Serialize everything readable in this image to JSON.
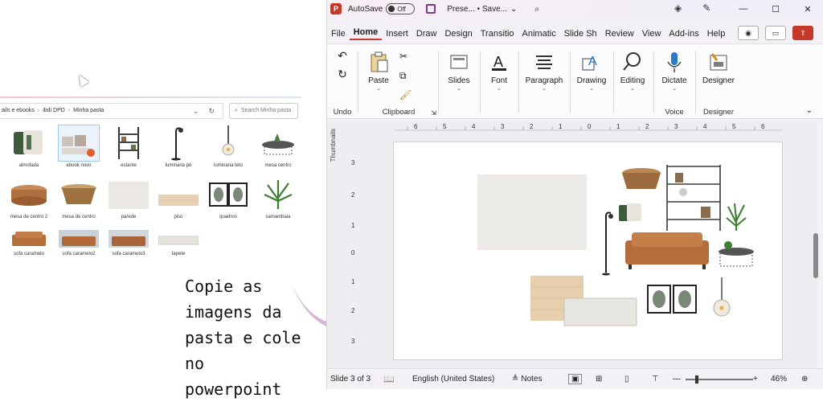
{
  "explorer": {
    "breadcrumb": [
      "ails e ebooks",
      "ibdi DPD",
      "Minha pasta"
    ],
    "search_placeholder": "Search Minha pasta",
    "files": [
      {
        "name": "almofada"
      },
      {
        "name": "ebook novo"
      },
      {
        "name": "estante"
      },
      {
        "name": "luminaria pé"
      },
      {
        "name": "luminaria teto"
      },
      {
        "name": "mesa centro"
      },
      {
        "name": "mesa de centro 2"
      },
      {
        "name": "mesa de centro"
      },
      {
        "name": "parede"
      },
      {
        "name": "piso"
      },
      {
        "name": "quadros"
      },
      {
        "name": "samambaia"
      },
      {
        "name": "sofa caramelo"
      },
      {
        "name": "sofa caramelo2"
      },
      {
        "name": "sofa caramelo3"
      },
      {
        "name": "tapete"
      }
    ]
  },
  "annotation": {
    "lines": [
      "Copie as",
      "imagens da",
      "pasta e cole no",
      "powerpoint"
    ],
    "arrow_color": "#d7b6d8"
  },
  "ppt": {
    "titlebar": {
      "autosave_label": "AutoSave",
      "toggle_state": "Off",
      "doc_title": "Prese... • Save...",
      "window_controls": [
        "—",
        "☐",
        "✕"
      ]
    },
    "tabs": [
      "File",
      "Home",
      "Insert",
      "Draw",
      "Design",
      "Transitio",
      "Animatic",
      "Slide Sh",
      "Review",
      "View",
      "Add-ins",
      "Help"
    ],
    "active_tab": "Home",
    "ribbon": {
      "undo_label": "Undo",
      "clipboard_label": "Clipboard",
      "paste_label": "Paste",
      "slides_label": "Slides",
      "font_label": "Font",
      "paragraph_label": "Paragraph",
      "drawing_label": "Drawing",
      "editing_label": "Editing",
      "dictate_label": "Dictate",
      "voice_label": "Voice",
      "designer_label": "Designer",
      "designer_group_label": "Designer"
    },
    "thumbnails_label": "Thumbnails",
    "ruler_h_ticks": [
      "6",
      "5",
      "4",
      "3",
      "2",
      "1",
      "0",
      "1",
      "2",
      "3",
      "4",
      "5",
      "6"
    ],
    "ruler_v_ticks": [
      "3",
      "2",
      "1",
      "0",
      "1",
      "2",
      "3"
    ],
    "status": {
      "slide_info": "Slide 3 of 3",
      "language": "English (United States)",
      "notes_label": "Notes",
      "zoom": "46%"
    },
    "accent_color": "#c4392a"
  }
}
